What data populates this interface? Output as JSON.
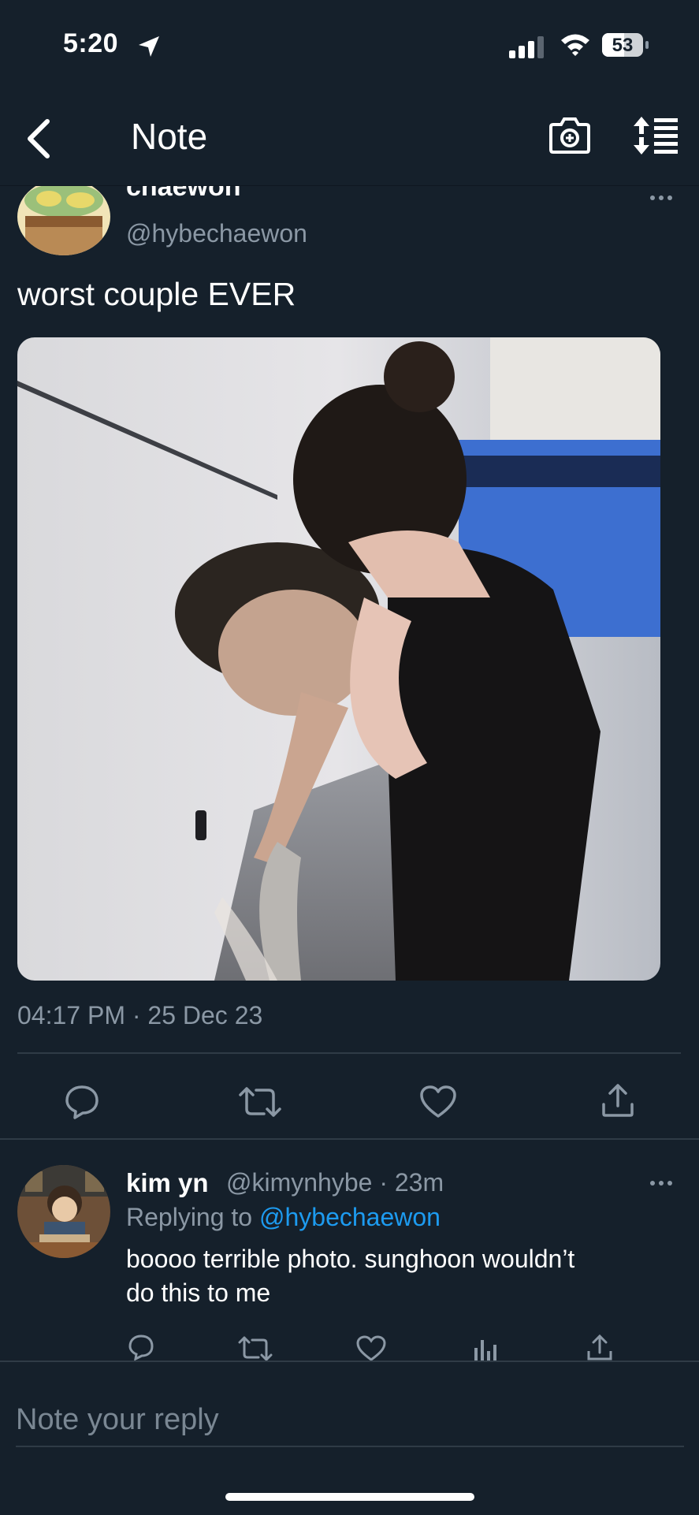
{
  "status_bar": {
    "time": "5:20",
    "battery": "53"
  },
  "header": {
    "title": "Note"
  },
  "tweet": {
    "display_name": "chaewon",
    "handle": "@hybechaewon",
    "text": "worst couple EVER",
    "timestamp": "04:17 PM · 25 Dec 23"
  },
  "reply": {
    "display_name": "kim yn",
    "handle_time": "@kimynhybe · 23m",
    "replying_prefix": "Replying to",
    "replying_handle": "@hybechaewon",
    "text_line1": "boooo terrible photo. sunghoon wouldn’t",
    "text_line2": "do this to me"
  },
  "compose": {
    "placeholder": "Note your reply"
  },
  "colors": {
    "background": "#15202b",
    "accent": "#1d9bf0",
    "muted": "#8b98a5",
    "divider": "#2f3b46"
  }
}
